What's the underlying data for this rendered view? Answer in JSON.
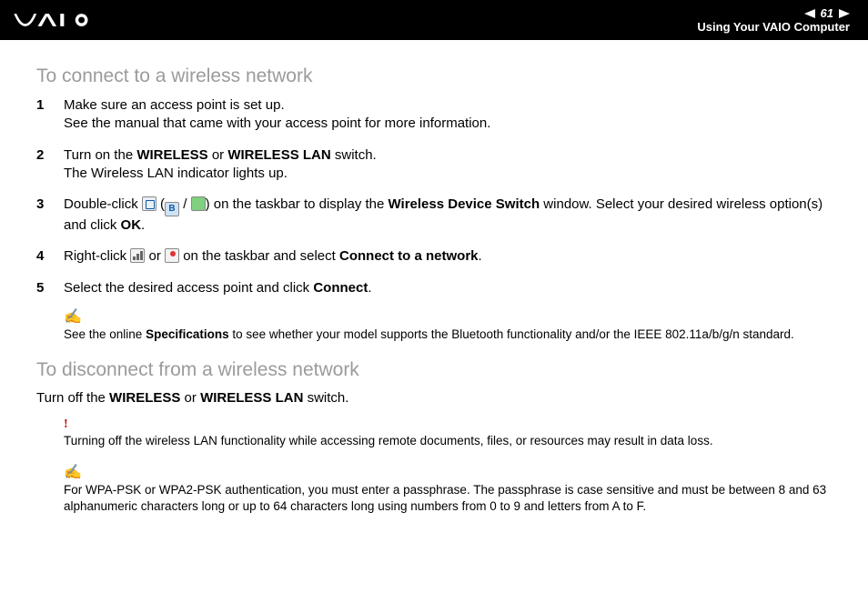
{
  "header": {
    "page_number": "61",
    "section": "Using Your VAIO Computer"
  },
  "main": {
    "heading1": "To connect to a wireless network",
    "steps": [
      {
        "n": "1",
        "a": "Make sure an access point is set up.",
        "b": "See the manual that came with your access point for more information."
      },
      {
        "n": "2",
        "a": "Turn on the ",
        "bold1": "WIRELESS",
        "mid1": " or ",
        "bold2": "WIRELESS LAN",
        "a2": " switch.",
        "b": "The Wireless LAN indicator lights up."
      },
      {
        "n": "3",
        "a": "Double-click ",
        "paren_open": " (",
        "slash": " / ",
        "paren_close": ") on the taskbar to display the ",
        "bold1": "Wireless Device Switch",
        "a2": " window. Select your desired wireless option(s) and click ",
        "bold2": "OK",
        "a3": "."
      },
      {
        "n": "4",
        "a": "Right-click ",
        "mid": " or ",
        "a2": " on the taskbar and select ",
        "bold1": "Connect to a network",
        "a3": "."
      },
      {
        "n": "5",
        "a": "Select the desired access point and click ",
        "bold1": "Connect",
        "a2": "."
      }
    ],
    "note1_a": "See the online ",
    "note1_bold": "Specifications",
    "note1_b": " to see whether your model supports the Bluetooth functionality and/or the IEEE 802.11a/b/g/n standard.",
    "heading2": "To disconnect from a wireless network",
    "disconnect_a": "Turn off the ",
    "disconnect_bold1": "WIRELESS",
    "disconnect_mid": " or ",
    "disconnect_bold2": "WIRELESS LAN",
    "disconnect_b": " switch.",
    "warning": "Turning off the wireless LAN functionality while accessing remote documents, files, or resources may result in data loss.",
    "note2": "For WPA-PSK or WPA2-PSK authentication, you must enter a passphrase. The passphrase is case sensitive and must be between 8 and 63 alphanumeric characters long or up to 64 characters long using numbers from 0 to 9 and letters from A to F."
  }
}
